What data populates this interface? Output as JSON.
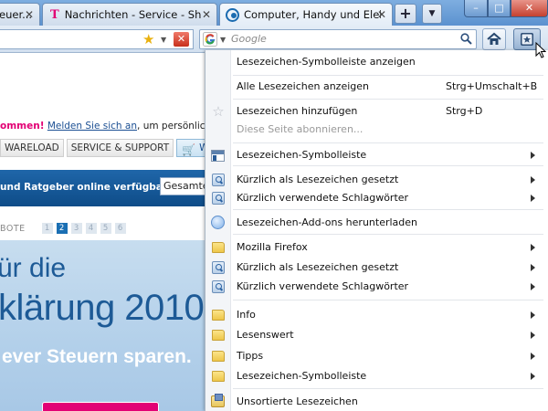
{
  "tabs": [
    {
      "label": "euer...",
      "active": false
    },
    {
      "label": "Nachrichten - Service - Sho...",
      "active": false
    },
    {
      "label": "Computer, Handy und Elekt...",
      "active": true
    }
  ],
  "newtab_label": "+",
  "window": {
    "min": "–",
    "max": "□",
    "close": "✕"
  },
  "search": {
    "placeholder": "Google"
  },
  "page": {
    "login_prefix": "ommen!",
    "login_link": "Melden Sie sich an",
    "login_suffix": ", um persönliche Em",
    "nav": [
      "WARELOAD",
      "SERVICE & SUPPORT",
      "WA"
    ],
    "band_text": "und Ratgeber online verfügbar.",
    "select_value": "Gesamte",
    "pager_label": "BOTE",
    "pages": [
      "1",
      "2",
      "3",
      "4",
      "5",
      "6"
    ],
    "active_page": "2",
    "hero_line1": "ür die",
    "hero_line2": "klärung 2010",
    "hero_line3": "ever Steuern sparen."
  },
  "menu": {
    "items": [
      {
        "label": "Lesezeichen-Symbolleiste anzeigen",
        "shortcut": "",
        "submenu": false,
        "disabled": false,
        "icon": "none"
      },
      {
        "label": "Alle Lesezeichen anzeigen",
        "shortcut": "Strg+Umschalt+B",
        "submenu": false,
        "disabled": false,
        "icon": "none"
      },
      {
        "label": "Lesezeichen hinzufügen",
        "shortcut": "Strg+D",
        "submenu": false,
        "disabled": false,
        "icon": "star-outline-icon"
      },
      {
        "label": "Diese Seite abonnieren...",
        "shortcut": "",
        "submenu": false,
        "disabled": true,
        "icon": "none"
      },
      {
        "label": "Lesezeichen-Symbolleiste",
        "shortcut": "",
        "submenu": true,
        "disabled": false,
        "icon": "toolbar-icon"
      },
      {
        "label": "Kürzlich als Lesezeichen gesetzt",
        "shortcut": "",
        "submenu": true,
        "disabled": false,
        "icon": "smart-folder-icon"
      },
      {
        "label": "Kürzlich verwendete Schlagwörter",
        "shortcut": "",
        "submenu": true,
        "disabled": false,
        "icon": "smart-folder-icon"
      },
      {
        "label": "Lesezeichen-Add-ons herunterladen",
        "shortcut": "",
        "submenu": false,
        "disabled": false,
        "icon": "addon-icon"
      },
      {
        "label": "Mozilla Firefox",
        "shortcut": "",
        "submenu": true,
        "disabled": false,
        "icon": "folder-icon"
      },
      {
        "label": "Kürzlich als Lesezeichen gesetzt",
        "shortcut": "",
        "submenu": true,
        "disabled": false,
        "icon": "smart-folder-icon"
      },
      {
        "label": "Kürzlich verwendete Schlagwörter",
        "shortcut": "",
        "submenu": true,
        "disabled": false,
        "icon": "smart-folder-icon"
      },
      {
        "label": "Info",
        "shortcut": "",
        "submenu": true,
        "disabled": false,
        "icon": "folder-icon"
      },
      {
        "label": "Lesenswert",
        "shortcut": "",
        "submenu": true,
        "disabled": false,
        "icon": "folder-icon"
      },
      {
        "label": "Tipps",
        "shortcut": "",
        "submenu": true,
        "disabled": false,
        "icon": "folder-icon"
      },
      {
        "label": "Lesezeichen-Symbolleiste",
        "shortcut": "",
        "submenu": true,
        "disabled": false,
        "icon": "folder-icon"
      },
      {
        "label": "Unsortierte Lesezeichen",
        "shortcut": "",
        "submenu": false,
        "disabled": false,
        "icon": "unsorted-bookmarks-icon"
      }
    ]
  },
  "colors": {
    "accent": "#1b6bb0",
    "brand_magenta": "#e20074"
  }
}
